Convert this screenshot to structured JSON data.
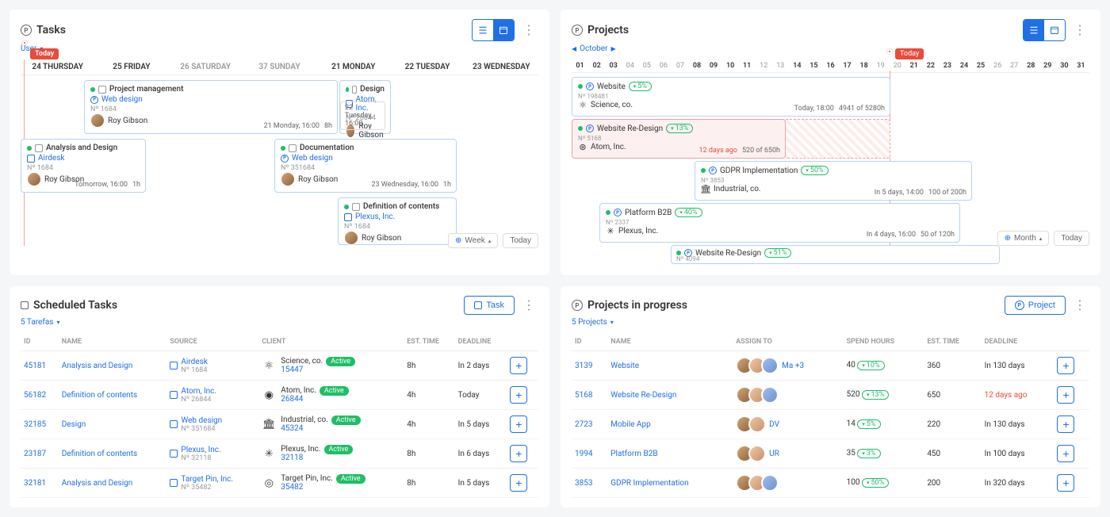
{
  "tasks_panel": {
    "title": "Tasks",
    "subhead": "User",
    "today_label": "Today",
    "days": [
      {
        "label": "24 THURSDAY",
        "active": true
      },
      {
        "label": "25 FRIDAY",
        "active": true
      },
      {
        "label": "26 SATURDAY",
        "active": false
      },
      {
        "label": "37 SUNDAY",
        "active": false
      },
      {
        "label": "21 MONDAY",
        "active": true
      },
      {
        "label": "22 TUESDAY",
        "active": true
      },
      {
        "label": "23 WEDNESDAY",
        "active": true
      }
    ],
    "cards": {
      "pm": {
        "title": "Project management",
        "proj": "Web design",
        "num": "Nº 1684",
        "assignee": "Roy Gibson",
        "due": "21 Monday, 16:00",
        "hours": "8h"
      },
      "ad": {
        "title": "Analysis and Design",
        "proj": "Airdesk",
        "num": "Nº 1684",
        "assignee": "Roy Gibson",
        "due": "Tomorrow, 16:00",
        "hours": "1h"
      },
      "doc": {
        "title": "Documentation",
        "proj": "Web design",
        "num": "Nº 351684",
        "assignee": "Roy Gibson",
        "due": "23 Wednesday, 16:00",
        "hours": "1h"
      },
      "des": {
        "title": "Design",
        "comp": "Atom, Inc.",
        "num": "Nº 26844",
        "assignee": "Roy Gibson",
        "due": "22 Tuesday, 16:00"
      },
      "def": {
        "title": "Definition of contents",
        "comp": "Plexus, Inc.",
        "num": "Nº 1684",
        "assignee": "Roy Gibson"
      }
    },
    "view_period": "Week",
    "today_btn": "Today"
  },
  "projects_panel": {
    "title": "Projects",
    "subhead": "October",
    "today_label": "Today",
    "days": [
      "01",
      "02",
      "03",
      "04",
      "05",
      "06",
      "07",
      "08",
      "09",
      "10",
      "11",
      "12",
      "13",
      "14",
      "15",
      "16",
      "17",
      "18",
      "19",
      "20",
      "21",
      "22",
      "23",
      "24",
      "25",
      "26",
      "27",
      "28",
      "29",
      "30",
      "31"
    ],
    "dark_days": [
      "01",
      "02",
      "03",
      "08",
      "09",
      "10",
      "11",
      "14",
      "15",
      "16",
      "17",
      "18",
      "21",
      "22",
      "23",
      "24",
      "25",
      "28",
      "29",
      "30",
      "31"
    ],
    "cards": {
      "web": {
        "title": "Website",
        "pct": "5%",
        "num": "Nº 198481",
        "comp": "Science, co.",
        "due": "Today, 18:00",
        "hours": "4941 of 5280h"
      },
      "redesign": {
        "title": "Website Re-Design",
        "pct": "13%",
        "num": "Nº 5168",
        "comp": "Atom, Inc.",
        "due": "12 days ago",
        "due_red": true,
        "hours": "520 of 650h"
      },
      "gdpr": {
        "title": "GDPR Implementation",
        "pct": "50%",
        "num": "Nº 3853",
        "comp": "Industrial, co.",
        "due": "In 5 days, 14:00",
        "hours": "100 of 200h"
      },
      "plat": {
        "title": "Platform B2B",
        "pct": "40%",
        "num": "Nº 2337",
        "comp": "Plexus, Inc.",
        "due": "In 4 days, 16:00",
        "hours": "50 of 120h"
      },
      "redesign2": {
        "title": "Website Re-Design",
        "pct": "51%",
        "num": "Nº 4094"
      }
    },
    "view_period": "Month",
    "today_btn": "Today"
  },
  "scheduled_panel": {
    "title": "Scheduled Tasks",
    "subhead": "5 Tarefas",
    "task_btn": "Task",
    "headers": [
      "ID",
      "NAME",
      "SOURCE",
      "CLIENT",
      "EST. TIME",
      "DEADLINE",
      ""
    ],
    "rows": [
      {
        "id": "45181",
        "name": "Analysis and Design",
        "source": "Airdesk",
        "source_num": "Nº 1684",
        "client": "Science, co.",
        "client_num": "15447",
        "est": "8h",
        "deadline": "In 2 days",
        "logo": "⚛"
      },
      {
        "id": "56182",
        "name": "Definition of contents",
        "source": "Atom, Inc.",
        "source_num": "Nº 26844",
        "client": "Atom, Inc.",
        "client_num": "26844",
        "est": "4h",
        "deadline": "Today",
        "logo": "◉"
      },
      {
        "id": "32185",
        "name": "Design",
        "source": "Web design",
        "source_num": "Nº 351684",
        "client": "Industrial, co.",
        "client_num": "45324",
        "est": "4h",
        "deadline": "In 5 days",
        "logo": "🏛"
      },
      {
        "id": "23187",
        "name": "Definition of contents",
        "source": "Plexus, Inc.",
        "source_num": "Nº 32118",
        "client": "Plexus, Inc.",
        "client_num": "32118",
        "est": "8h",
        "deadline": "In 6 days",
        "logo": "✳"
      },
      {
        "id": "32181",
        "name": "Analysis and Design",
        "source": "Target Pin, Inc.",
        "source_num": "Nº 35482",
        "client": "Target Pin, Inc.",
        "client_num": "35482",
        "est": "8h",
        "deadline": "In 5 days",
        "logo": "◎"
      }
    ],
    "active_label": "Active"
  },
  "progress_panel": {
    "title": "Projects in progress",
    "subhead": "5 Projects",
    "project_btn": "Project",
    "headers": [
      "ID",
      "NAME",
      "ASSIGN TO",
      "SPEND HOURS",
      "EST. TIME",
      "DEADLINE",
      ""
    ],
    "rows": [
      {
        "id": "3139",
        "name": "Website",
        "more": "Ma +3",
        "spend": "40",
        "pct": "10%",
        "est": "360",
        "deadline": "In 130 days",
        "avcount": 3
      },
      {
        "id": "5168",
        "name": "Website Re-Design",
        "more": "",
        "spend": "520",
        "pct": "13%",
        "est": "650",
        "deadline": "12 days ago",
        "deadline_red": true,
        "avcount": 3
      },
      {
        "id": "2723",
        "name": "Mobile App",
        "more": "DV",
        "spend": "14",
        "pct": "5%",
        "est": "220",
        "deadline": "In 130 days",
        "avcount": 2
      },
      {
        "id": "1994",
        "name": "Platform B2B",
        "more": "UR",
        "spend": "35",
        "pct": "3%",
        "est": "450",
        "deadline": "In 100 days",
        "avcount": 2
      },
      {
        "id": "3853",
        "name": "GDPR Implementation",
        "more": "",
        "spend": "100",
        "pct": "50%",
        "est": "200",
        "deadline": "In 320 days",
        "avcount": 3
      }
    ]
  }
}
